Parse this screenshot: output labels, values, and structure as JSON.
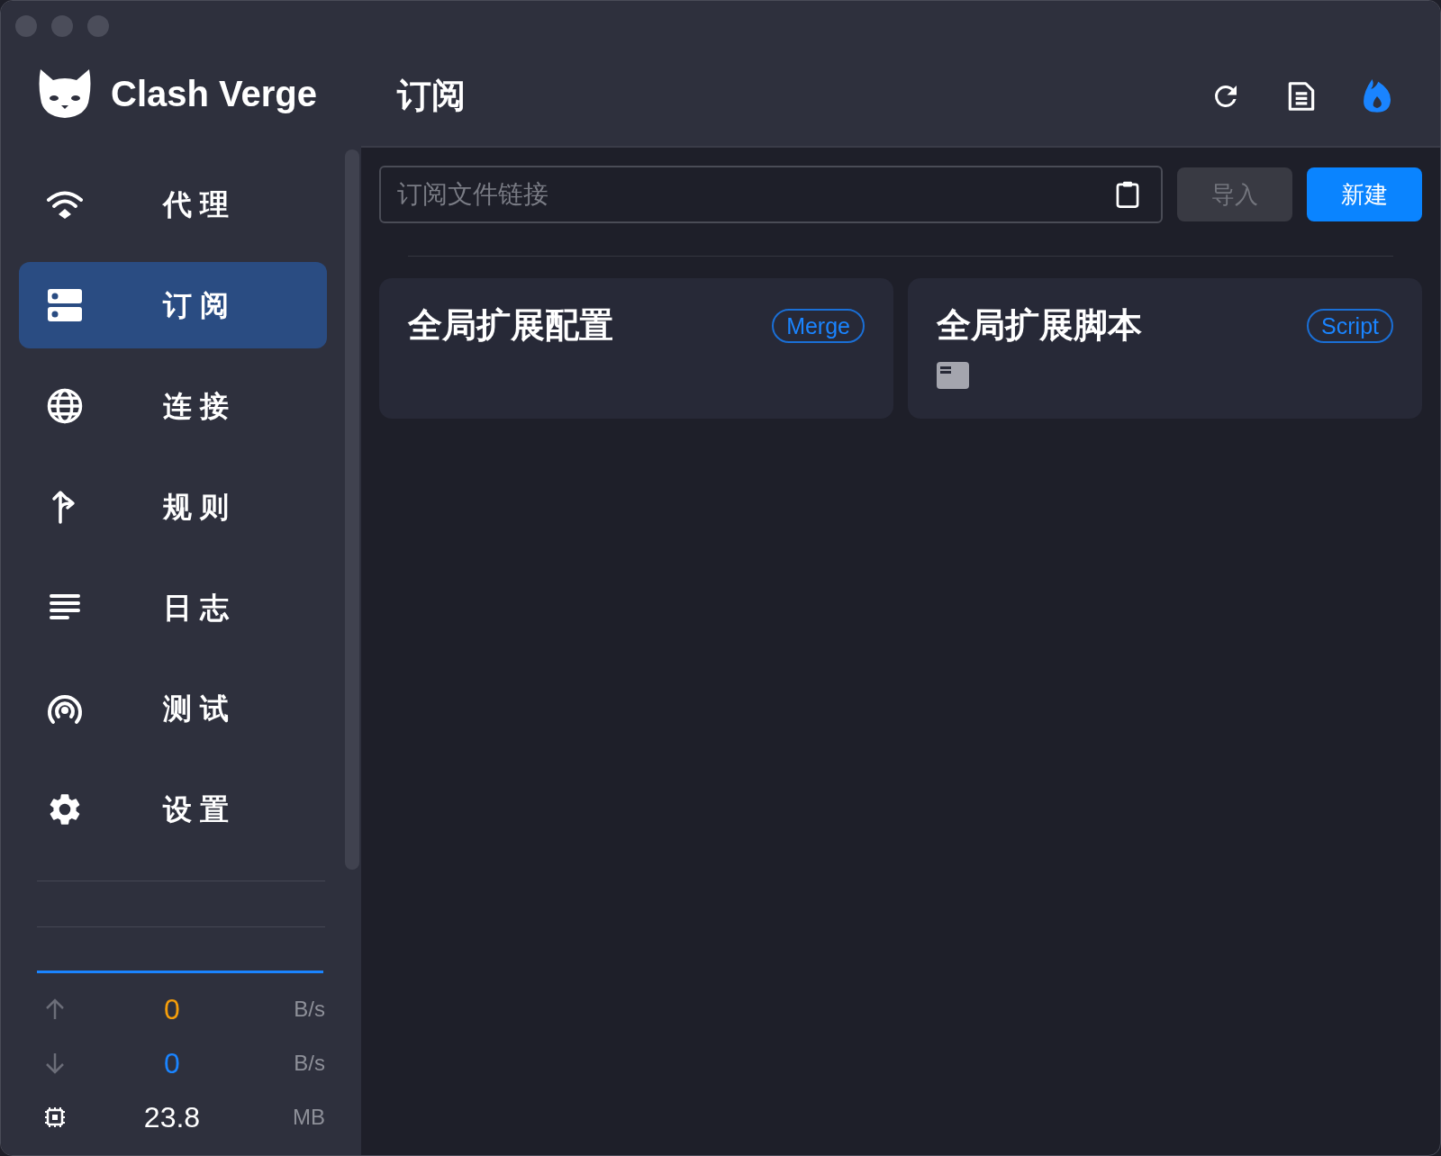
{
  "app": {
    "name": "Clash Verge"
  },
  "nav": [
    {
      "label": "代 理",
      "selected": false
    },
    {
      "label": "订 阅",
      "selected": true
    },
    {
      "label": "连 接",
      "selected": false
    },
    {
      "label": "规 则",
      "selected": false
    },
    {
      "label": "日 志",
      "selected": false
    },
    {
      "label": "测 试",
      "selected": false
    },
    {
      "label": "设 置",
      "selected": false
    }
  ],
  "traffic": [
    {
      "kind": "upload",
      "value": "0",
      "unit": "B/s",
      "color": "#f59e0b"
    },
    {
      "kind": "download",
      "value": "0",
      "unit": "B/s",
      "color": "#1a84ff"
    },
    {
      "kind": "memory",
      "value": "23.8",
      "unit": "MB",
      "color": "#ffffff"
    }
  ],
  "header": {
    "title": "订阅"
  },
  "url_field": {
    "placeholder": "订阅文件链接"
  },
  "buttons": [
    {
      "label": "导入",
      "disabled": true
    },
    {
      "label": "新建",
      "disabled": false
    }
  ],
  "cards": [
    {
      "title": "全局扩展配置",
      "badge": "Merge",
      "has_file_icon": false
    },
    {
      "title": "全局扩展脚本",
      "badge": "Script",
      "has_file_icon": true
    }
  ]
}
